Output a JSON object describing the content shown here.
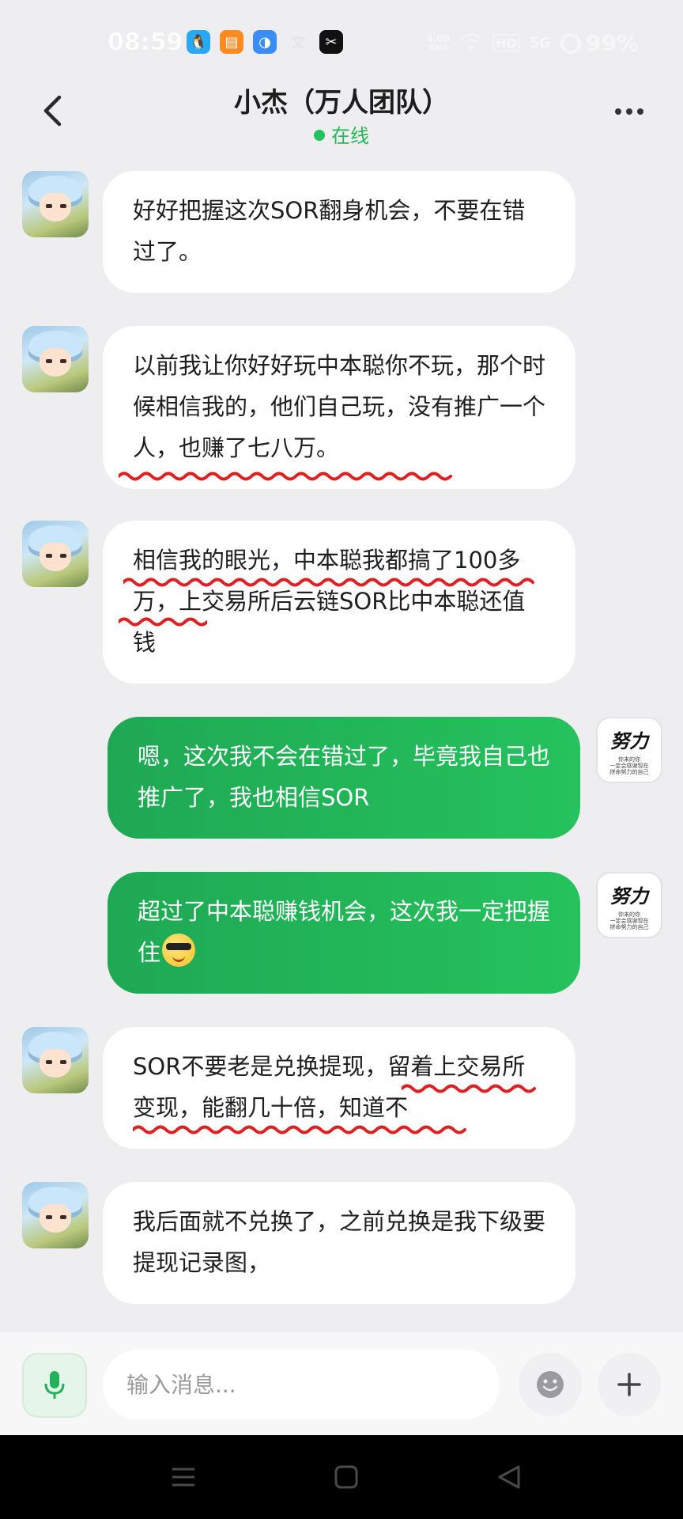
{
  "status_bar": {
    "time": "08:59",
    "apps": [
      {
        "icon": "penguin-icon",
        "glyph": "🐧",
        "color": "#2aa9f3"
      },
      {
        "icon": "calendar-app-icon",
        "glyph": "▤",
        "color": "#ff8a1f"
      },
      {
        "icon": "planet-app-icon",
        "glyph": "◑",
        "color": "#3a8df5"
      },
      {
        "icon": "translate-app-icon",
        "glyph": "文",
        "color": "#e6e6e6"
      },
      {
        "icon": "capcut-icon",
        "glyph": "✂",
        "color": "#111111"
      }
    ],
    "dot": "•",
    "net_speed_value": "4.00",
    "net_speed_unit": "KB/S",
    "wifi_icon": "wifi-icon",
    "hd_label": "HD",
    "signal_label": "5G",
    "battery": "99%"
  },
  "header": {
    "title": "小杰（万人团队）",
    "status": "在线",
    "status_color": "#22c35e"
  },
  "messages": [
    {
      "side": "in",
      "text": "好好把握这次SOR翻身机会，不要在错过了。"
    },
    {
      "side": "in",
      "text": "以前我让你好好玩中本聪你不玩，那个时候相信我的，他们自己玩，没有推广一个人，也赚了七八万。"
    },
    {
      "side": "in",
      "text": "相信我的眼光，中本聪我都搞了100多万，上交易所后云链SOR比中本聪还值钱"
    },
    {
      "side": "out",
      "text": "嗯，这次我不会在错过了，毕竟我自己也推广了，我也相信SOR"
    },
    {
      "side": "out",
      "text": "超过了中本聪赚钱机会，这次我一定把握住",
      "emoji": "sunglasses-emoji"
    },
    {
      "side": "in",
      "text": "SOR不要老是兑换提现，留着上交易所变现，能翻几十倍，知道不"
    },
    {
      "side": "in",
      "text": "我后面就不兑换了，之前兑换是我下级要提现记录图，"
    }
  ],
  "self_avatar": {
    "big": "努力",
    "small_1": "你未的你",
    "small_2": "一定会感谢现在",
    "small_3": "拼命努力的自己"
  },
  "input": {
    "placeholder": "输入消息..."
  },
  "colors": {
    "accent_green": "#22c35e",
    "annotation_red": "#e02020"
  }
}
